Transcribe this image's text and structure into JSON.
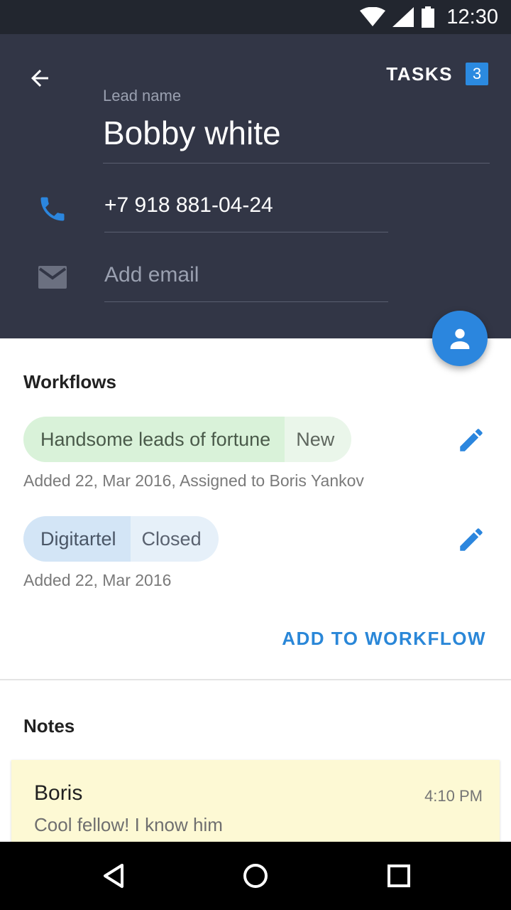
{
  "status_bar": {
    "time": "12:30",
    "icons": [
      "wifi-icon",
      "signal-icon",
      "battery-icon"
    ]
  },
  "header": {
    "back_icon": "arrow-left-icon",
    "tasks_label": "TASKS",
    "tasks_count": "3",
    "lead_label": "Lead name",
    "lead_name": "Bobby white",
    "phone": "+7 918 881-04-24",
    "email_placeholder": "Add email",
    "fab_icon": "person-icon"
  },
  "workflows": {
    "title": "Workflows",
    "items": [
      {
        "name": "Handsome leads of fortune",
        "status": "New",
        "meta": "Added 22, Mar 2016, Assigned to Boris Yankov",
        "color": "#d9f2d9"
      },
      {
        "name": "Digitartel",
        "status": "Closed",
        "meta": "Added 22, Mar 2016",
        "color": "#d3e5f6"
      }
    ],
    "add_label": "ADD TO WORKFLOW"
  },
  "notes": {
    "title": "Notes",
    "items": [
      {
        "author": "Boris",
        "time": "4:10 PM",
        "text": "Cool fellow! I know him"
      }
    ]
  },
  "colors": {
    "header_bg": "#323646",
    "accent": "#2b86de",
    "note_bg": "#fdf9d4"
  }
}
